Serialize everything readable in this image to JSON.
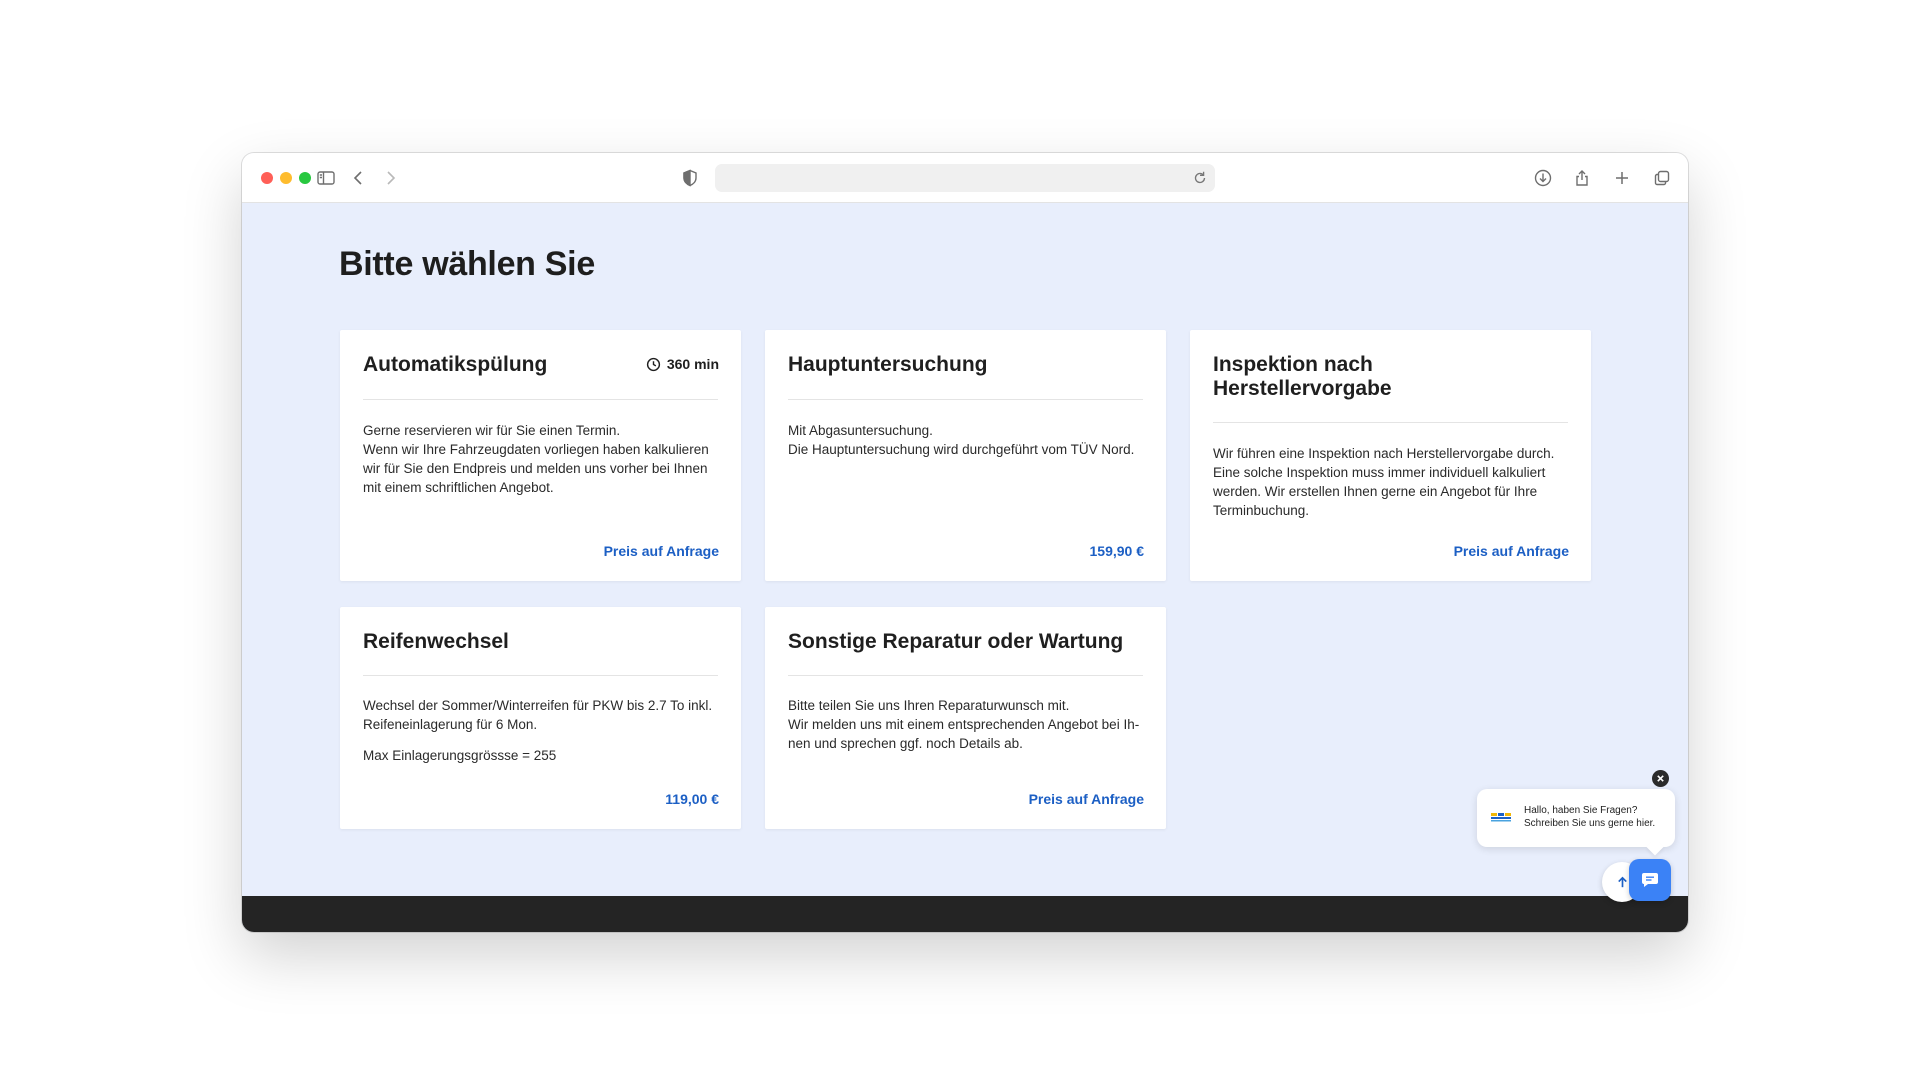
{
  "page": {
    "title": "Bitte wählen Sie"
  },
  "browser": {
    "url": ""
  },
  "cards": [
    {
      "title": "Automatikspülung",
      "duration": "360 min",
      "description": [
        "Gerne reservieren wir für Sie einen Termin.",
        "Wenn wir Ihre Fahrzeugdaten vorliegen haben kalkulieren",
        "wir für Sie den Endpreis und melden uns vorher bei Ihnen",
        "mit einem schriftlichen Angebot."
      ],
      "price": "Preis auf Anfrage"
    },
    {
      "title": "Hauptuntersuchung",
      "description": [
        "Mit Abgasuntersuchung.",
        "Die Hauptuntersuchung wird durchgeführt vom TÜV Nord."
      ],
      "price": "159,90 €"
    },
    {
      "title": "Inspektion nach Herstellervorgabe",
      "description": [
        "Wir führen eine Inspektion nach Herstellervorgabe durch.",
        "Eine solche Inspektion muss immer individuell kalkuliert",
        "werden. Wir erstellen Ihnen gerne ein Angebot für Ihre",
        "Terminbuchung."
      ],
      "price": "Preis auf Anfrage"
    },
    {
      "title": "Reifenwechsel",
      "description": [
        "Wechsel der Sommer/Winterreifen für PKW bis 2.7 To inkl.",
        "Reifeneinlagerung für 6 Mon."
      ],
      "description_extra": "Max Einlagerungsgrössse = 255",
      "price": "119,00 €"
    },
    {
      "title": "Sonstige Reparatur oder Wartung",
      "description": [
        "Bitte teilen Sie uns Ihren Reparaturwunsch mit.",
        "Wir melden uns mit einem entsprechenden Angebot bei Ih-",
        "nen und sprechen ggf. noch Details ab."
      ],
      "price": "Preis auf Anfrage"
    }
  ],
  "chat": {
    "line1": "Hallo, haben Sie Fragen?",
    "line2": "Schreiben Sie uns gerne hier."
  },
  "colors": {
    "background": "#e8eefc",
    "price": "#1c5fc4",
    "chat_button": "#3b82f6",
    "footer": "#242424"
  },
  "icons": {
    "sidebar": "sidebar-icon",
    "back": "chevron-left-icon",
    "forward": "chevron-right-icon",
    "privacy": "shield-icon",
    "reload": "reload-icon",
    "download": "download-icon",
    "share": "share-icon",
    "new_tab": "plus-icon",
    "tabs": "tabs-icon",
    "duration": "clock-icon",
    "close": "close-icon",
    "scroll_top": "arrow-up-icon",
    "chat": "chat-icon"
  }
}
